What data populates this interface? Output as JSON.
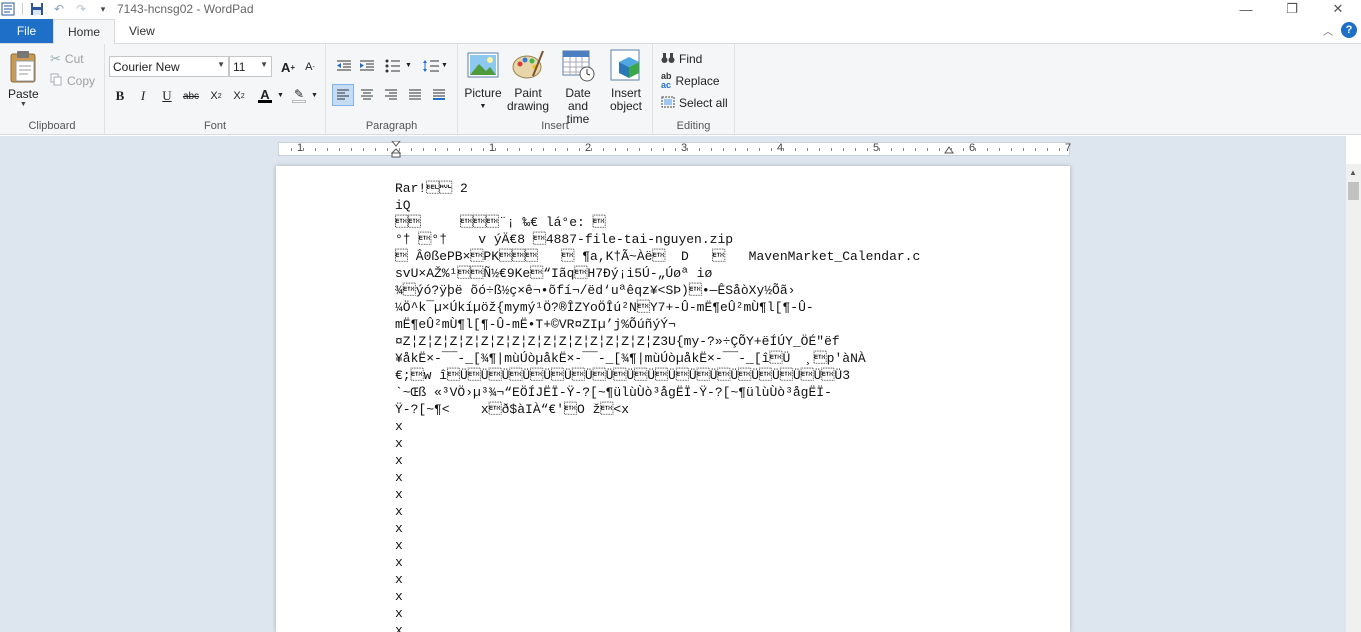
{
  "window": {
    "title": "7143-hcnsg02 - WordPad",
    "minimize": "—",
    "maximize": "❐",
    "close": "✕"
  },
  "tabs": [
    {
      "label": "File"
    },
    {
      "label": "Home"
    },
    {
      "label": "View"
    }
  ],
  "ribbon": {
    "clipboard": {
      "label": "Clipboard",
      "paste": "Paste",
      "cut": "Cut",
      "copy": "Copy"
    },
    "font": {
      "label": "Font",
      "family": "Courier New",
      "size": "11"
    },
    "paragraph": {
      "label": "Paragraph"
    },
    "insert": {
      "label": "Insert",
      "picture": "Picture",
      "paint_drawing_1": "Paint",
      "paint_drawing_2": "drawing",
      "date_time_1": "Date and",
      "date_time_2": "time",
      "insert_object_1": "Insert",
      "insert_object_2": "object"
    },
    "editing": {
      "label": "Editing",
      "find": "Find",
      "replace": "Replace",
      "select_all": "Select all"
    }
  },
  "ruler": {
    "numbers": [
      "1",
      "1",
      "2",
      "3",
      "4",
      "5",
      "6",
      "7"
    ]
  },
  "document": {
    "lines": [
      "Rar!\u0007\u0000 2",
      "iQ",
      "\u0003\u0003     \u0003\u0003\u0003¨¡ ‰€ lá°e: \u0003",
      "°† \u0003°†    v ýÄ€8 \u00034887-file-tai-nguyen.zip",
      "\u0003 Â0ßePB×\u0003PK\u0003\u0003\u0003   \u0003 ¶a,K†Ã~Àë\u0003  D   \u0003   MavenMarket_Calendar.c",
      "svU×AŽ%¹\u0003\u0003Ñ½€9Ke\u0003“Iãq\u0003H7Ðý¡i5Ú-„Úøª iø",
      "¾\u0003ýó?ÿþë õó÷ß½ç×ê¬•õfí¬/ëd‘uªêqz¥<SÞ)\u0003•—ÊSåòXy½Õã›",
      "¼Ö^k¯µ×Úkíµöž{mymý¹Ö?®ÎZYoÖÎú²N\u0003Y7+-Û-mË¶eÛ²mÙ¶l[¶-Û-",
      "mË¶eÛ²mÙ¶l[¶-Û-mË•T+©VR¤ZIµ’j%ÕúñýÝ¬",
      "¤Z¦Z¦Z¦Z¦Z¦Z¦Z¦Z¦Z¦Z¦Z¦Z¦Z¦Z¦Z¦Z¦Z3U{my-?»÷ÇÕY+ëÍÚY_ÖÉ\"ëf",
      "¥åkË×-¯¯-_[¾¶|mùÚòµåkË×-¯¯-_[¾¶|mùÚòµåkË×-¯¯-_[î\u0003Ü  ¸\u0003p'àNÀ",
      "€;\u0003w î\u0003Ü\u0003Ü\u0003Ü\u0003Ü\u0003Ü\u0003Ü\u0003Ü\u0003Ü\u0003Ü\u0003Ü\u0003Ü\u0003Ü\u0003Ü\u0003Ü\u0003Ü\u0003Ü\u0003Ü\u0003Ü\u0003Ü3",
      "`~Œß «³VÖ›µ³¾¬“EÖÍJËÏ-Ÿ-?[~¶ülùÙò³ågËÏ-Ÿ-?[~¶ülùÙò³ågËÏ-",
      "Ÿ-?[~¶<    x\u0003ð$àIÀ“€'\u0003O ž\u0003<x",
      "x",
      "x",
      "x",
      "x",
      "x",
      "x",
      "x",
      "x",
      "x",
      "x",
      "x",
      "x",
      "x"
    ]
  }
}
